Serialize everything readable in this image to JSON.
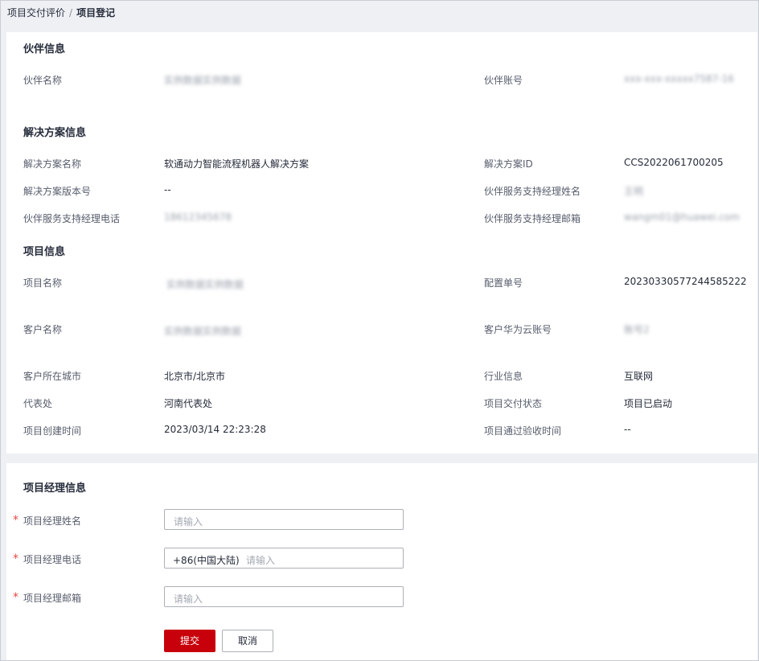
{
  "breadcrumb": {
    "parent": "项目交付评价",
    "separator": "/",
    "current": "项目登记"
  },
  "partner": {
    "title": "伙伴信息",
    "name_label": "伙伴名称",
    "name_value": "实例数据实例数据",
    "account_label": "伙伴账号",
    "account_value": "xxx-xxx-xxxxx7587-16"
  },
  "solution": {
    "title": "解决方案信息",
    "name_label": "解决方案名称",
    "name_value": "软通动力智能流程机器人解决方案",
    "id_label": "解决方案ID",
    "id_value": "CCS2022061700205",
    "version_label": "解决方案版本号",
    "version_value": "--",
    "manager_name_label": "伙伴服务支持经理姓名",
    "manager_name_value": "王明",
    "manager_phone_label": "伙伴服务支持经理电话",
    "manager_phone_value": "18612345678",
    "manager_email_label": "伙伴服务支持经理邮箱",
    "manager_email_value": "wangm01@huawei.com"
  },
  "project": {
    "title": "项目信息",
    "name_label": "项目名称",
    "name_value": "实例数据实例数据",
    "config_no_label": "配置单号",
    "config_no_value": "20230330577244585222",
    "customer_label": "客户名称",
    "customer_value": "实例数据实例数据",
    "cloud_account_label": "客户华为云账号",
    "cloud_account_value": "账号2",
    "city_label": "客户所在城市",
    "city_value": "北京市/北京市",
    "industry_label": "行业信息",
    "industry_value": "互联网",
    "office_label": "代表处",
    "office_value": "河南代表处",
    "status_label": "项目交付状态",
    "status_value": "项目已启动",
    "created_label": "项目创建时间",
    "created_value": "2023/03/14 22:23:28",
    "accepted_label": "项目通过验收时间",
    "accepted_value": "--"
  },
  "manager_form": {
    "title": "项目经理信息",
    "required_mark": "*",
    "name_label": "项目经理姓名",
    "name_placeholder": "请输入",
    "phone_label": "项目经理电话",
    "phone_prefix": "+86(中国大陆)",
    "phone_placeholder": "请输入",
    "email_label": "项目经理邮箱",
    "email_placeholder": "请输入",
    "submit_label": "提交",
    "cancel_label": "取消"
  },
  "colors": {
    "accent": "#c7000b",
    "required": "#e84545",
    "background": "#eef0f4"
  }
}
